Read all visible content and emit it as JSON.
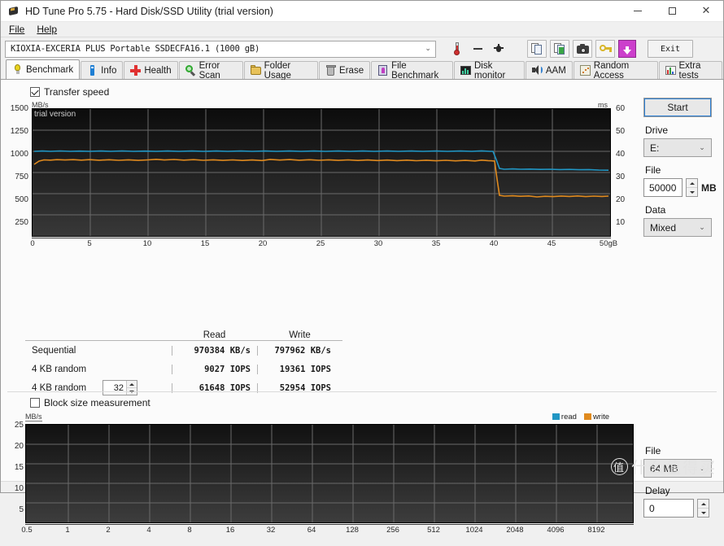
{
  "window": {
    "title": "HD Tune Pro 5.75 - Hard Disk/SSD Utility (trial version)",
    "app_icon": "hdtune-diamond-icon",
    "minimize": "minimize-icon",
    "maximize": "maximize-icon",
    "close": "close-icon"
  },
  "menu": {
    "items": [
      {
        "label": "File"
      },
      {
        "label": "Help"
      }
    ]
  },
  "toolbar": {
    "drive_selected": "KIOXIA-EXCERIA PLUS Portable SSDECFA16.1 (1000 gB)",
    "thermometer_icon": "thermometer-icon",
    "temp_value": "—",
    "bug_icon": "bug-icon",
    "buttons": [
      {
        "name": "copy-icon"
      },
      {
        "name": "copy-green-icon"
      },
      {
        "name": "camera-icon"
      },
      {
        "name": "key-icon"
      },
      {
        "name": "download-icon"
      }
    ],
    "exit_label": "Exit"
  },
  "tabs": [
    {
      "label": "Benchmark",
      "icon": "bulb-icon",
      "active": true
    },
    {
      "label": "Info",
      "icon": "info-icon",
      "active": false
    },
    {
      "label": "Health",
      "icon": "health-cross-icon",
      "active": false
    },
    {
      "label": "Error Scan",
      "icon": "magnifier-icon",
      "active": false
    },
    {
      "label": "Folder Usage",
      "icon": "folder-icon",
      "active": false
    },
    {
      "label": "Erase",
      "icon": "trash-icon",
      "active": false
    },
    {
      "label": "File Benchmark",
      "icon": "file-bench-icon",
      "active": false
    },
    {
      "label": "Disk monitor",
      "icon": "monitor-icon",
      "active": false
    },
    {
      "label": "AAM",
      "icon": "speaker-icon",
      "active": false
    },
    {
      "label": "Random Access",
      "icon": "random-icon",
      "active": false
    },
    {
      "label": "Extra tests",
      "icon": "extra-tests-icon",
      "active": false
    }
  ],
  "transfer_speed": {
    "checkbox_label": "Transfer speed",
    "checked": true,
    "trial_watermark": "trial version",
    "start_label": "Start",
    "drive_label": "Drive",
    "drive_value": "E:",
    "file_label": "File",
    "file_value": "50000",
    "file_unit": "MB",
    "data_label": "Data",
    "data_value": "Mixed"
  },
  "results": {
    "col_read": "Read",
    "col_write": "Write",
    "rows": [
      {
        "label": "Sequential",
        "read": "970384 KB/s",
        "write": "797962 KB/s",
        "spinner": null
      },
      {
        "label": "4 KB random",
        "read": "9027 IOPS",
        "write": "19361 IOPS",
        "spinner": null
      },
      {
        "label": "4 KB random",
        "read": "61648 IOPS",
        "write": "52954 IOPS",
        "spinner": "32"
      }
    ]
  },
  "block_size": {
    "checkbox_label": "Block size measurement",
    "checked": false,
    "file_label": "File",
    "file_value": "64 MB",
    "delay_label": "Delay",
    "delay_value": "0"
  },
  "legend": {
    "read": "read",
    "write": "write",
    "read_color": "#2196c4",
    "write_color": "#e08a1e"
  },
  "watermark": {
    "glyph": "值",
    "text": "什么值得买"
  },
  "chart_data": [
    {
      "type": "line",
      "id": "transfer-speed-chart",
      "title": "",
      "xlabel": "",
      "ylabel": "MB/s",
      "y2label": "ms",
      "xlim": [
        0,
        50
      ],
      "ylim": [
        0,
        1500
      ],
      "y2lim": [
        0,
        60
      ],
      "grid": true,
      "background": "#1b1b1b",
      "xticks": [
        0,
        5,
        10,
        15,
        20,
        25,
        30,
        35,
        40,
        45,
        50
      ],
      "xticklabels": [
        "0",
        "5",
        "10",
        "15",
        "20",
        "25",
        "30",
        "35",
        "40",
        "45",
        "50gB"
      ],
      "yticks": [
        250,
        500,
        750,
        1000,
        1250,
        1500
      ],
      "y2ticks": [
        10,
        20,
        30,
        40,
        50,
        60
      ],
      "legend_position": "none",
      "series": [
        {
          "name": "read",
          "color": "#2196c4",
          "axis": "y2",
          "units": "ms",
          "x": [
            0,
            2,
            4,
            6,
            8,
            10,
            12,
            14,
            16,
            18,
            20,
            22,
            24,
            26,
            28,
            30,
            32,
            34,
            36,
            38,
            39.5,
            40,
            40.5,
            41,
            42,
            44,
            46,
            48,
            50
          ],
          "values": [
            39.5,
            39.4,
            39.5,
            39.4,
            39.5,
            39.4,
            39.5,
            39.5,
            39.4,
            39.5,
            39.4,
            39.5,
            39.5,
            39.4,
            39.5,
            39.4,
            39.5,
            39.5,
            39.4,
            39.5,
            39.6,
            39.5,
            35,
            32.2,
            32.1,
            32.0,
            31.9,
            31.8,
            31.6
          ]
        },
        {
          "name": "write",
          "color": "#e08a1e",
          "axis": "y2",
          "units": "ms",
          "x": [
            0,
            1,
            2,
            4,
            6,
            8,
            10,
            12,
            14,
            16,
            18,
            20,
            22,
            24,
            26,
            28,
            30,
            32,
            34,
            36,
            38,
            39.5,
            40,
            40.5,
            41,
            42,
            44,
            46,
            48,
            50
          ],
          "values": [
            36.3,
            37.0,
            37.2,
            37.3,
            37.2,
            37.4,
            37.3,
            37.2,
            37.4,
            37.6,
            37.4,
            37.3,
            37.5,
            37.4,
            37.6,
            37.5,
            37.6,
            37.4,
            37.6,
            37.5,
            37.7,
            37.8,
            37.6,
            27,
            19.2,
            18.9,
            18.6,
            19.0,
            19.1,
            19.0
          ]
        }
      ],
      "notes": "Blue read line near 1000 MB/s falling to ~820 MB/s after 40 gB; orange write line near 920 MB/s falling to ~480 MB/s after 40 gB"
    },
    {
      "type": "bar",
      "id": "block-size-chart",
      "title": "",
      "xlabel": "",
      "ylabel": "MB/s",
      "ylim": [
        0,
        25
      ],
      "grid": true,
      "background": "#2a2a2a",
      "yticks": [
        5,
        10,
        15,
        20,
        25
      ],
      "xticklabels": [
        "0.5",
        "1",
        "2",
        "4",
        "8",
        "16",
        "32",
        "64",
        "128",
        "256",
        "512",
        "1024",
        "2048",
        "4096",
        "8192"
      ],
      "categories": [
        "0.5",
        "1",
        "2",
        "4",
        "8",
        "16",
        "32",
        "64",
        "128",
        "256",
        "512",
        "1024",
        "2048",
        "4096",
        "8192"
      ],
      "series": [
        {
          "name": "read",
          "color": "#2196c4",
          "values": [
            0,
            0,
            0,
            0,
            0,
            0,
            0,
            0,
            0,
            0,
            0,
            0,
            0,
            0,
            0
          ]
        },
        {
          "name": "write",
          "color": "#e08a1e",
          "values": [
            0,
            0,
            0,
            0,
            0,
            0,
            0,
            0,
            0,
            0,
            0,
            0,
            0,
            0,
            0
          ]
        }
      ],
      "legend_position": "top-right",
      "notes": "Empty chart - block size measurement not run"
    }
  ]
}
